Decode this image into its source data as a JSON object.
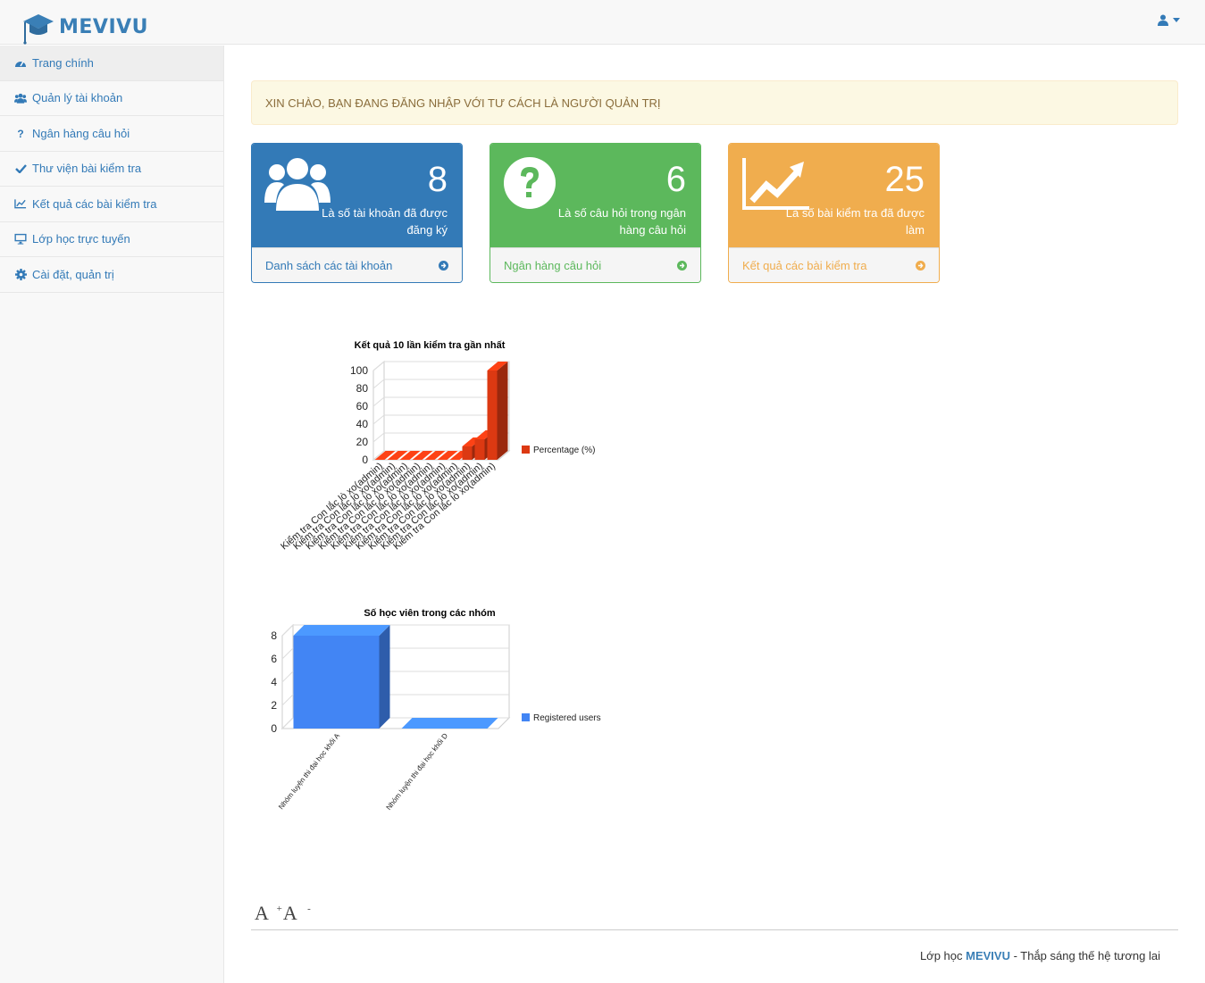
{
  "brand": {
    "name": "MEVIVU",
    "logo_icon": "graduation-cap-icon"
  },
  "navbar": {
    "user_icon": "user-icon"
  },
  "sidebar": {
    "items": [
      {
        "label": "Trang chính",
        "icon": "dashboard-icon"
      },
      {
        "label": "Quản lý tài khoản",
        "icon": "users-icon"
      },
      {
        "label": "Ngân hàng câu hỏi",
        "icon": "question-icon"
      },
      {
        "label": "Thư viện bài kiểm tra",
        "icon": "check-icon"
      },
      {
        "label": "Kết quả các bài kiểm tra",
        "icon": "line-chart-icon"
      },
      {
        "label": "Lớp học trực tuyến",
        "icon": "desktop-icon"
      },
      {
        "label": "Cài đặt, quản trị",
        "icon": "gear-icon"
      }
    ]
  },
  "alert": {
    "text": "XIN CHÀO, BẠN ĐANG ĐĂNG NHẬP VỚI TƯ CÁCH LÀ NGƯỜI QUẢN TRỊ"
  },
  "panels": [
    {
      "count": "8",
      "desc": "Là số tài khoản đã được đăng ký",
      "link": "Danh sách các tài khoản",
      "icon": "users-icon",
      "color": "#337ab7"
    },
    {
      "count": "6",
      "desc": "Là số câu hỏi trong ngân hàng câu hỏi",
      "link": "Ngân hàng câu hỏi",
      "icon": "question-circle-icon",
      "color": "#5cb85c"
    },
    {
      "count": "25",
      "desc": "Là số bài kiểm tra đã được làm",
      "link": "Kết quả các bài kiểm tra",
      "icon": "area-chart-icon",
      "color": "#f0ad4e"
    }
  ],
  "chart_data": [
    {
      "type": "bar",
      "title": "Kết quả 10 lần kiểm tra gần nhất",
      "categories": [
        "Kiểm tra Con lắc lò xo(admin)",
        "Kiểm tra Con lắc lò xo(admin)",
        "Kiểm tra Con lắc lò xo(admin)",
        "Kiểm tra Con lắc lò xo(admin)",
        "Kiểm tra Con lắc lò xo(admin)",
        "Kiểm tra Con lắc lò xo(admin)",
        "Kiểm tra Con lắc lò xo(admin)",
        "Kiểm tra Con lắc lò xo(admin)",
        "Kiểm tra Con lắc lò xo(admin)",
        "Kiểm tra Con lắc lò xo(admin)"
      ],
      "series": [
        {
          "name": "Percentage (%)",
          "values": [
            0,
            0,
            0,
            0,
            0,
            0,
            0,
            15,
            23,
            100
          ],
          "color": "#dc3912"
        }
      ],
      "yticks": [
        "0",
        "20",
        "40",
        "60",
        "80",
        "100"
      ],
      "ylim": [
        0,
        100
      ],
      "legend": "right",
      "grid": true
    },
    {
      "type": "bar",
      "title": "Số học viên trong các nhóm",
      "categories": [
        "Nhóm luyện thi đại học khối A",
        "Nhóm luyện thi đại học khối D"
      ],
      "series": [
        {
          "name": "Registered users",
          "values": [
            8,
            0
          ],
          "color": "#4285f4"
        }
      ],
      "yticks": [
        "0",
        "2",
        "4",
        "6",
        "8"
      ],
      "ylim": [
        0,
        8
      ],
      "legend": "right",
      "grid": true
    }
  ],
  "font_controls": {
    "increase": "A",
    "increase_sign": "+",
    "decrease": "A",
    "decrease_sign": "-"
  },
  "footer": {
    "prefix": "Lớp học ",
    "brand": "MEVIVU",
    "suffix": " - Thắp sáng thế hệ tương lai"
  }
}
